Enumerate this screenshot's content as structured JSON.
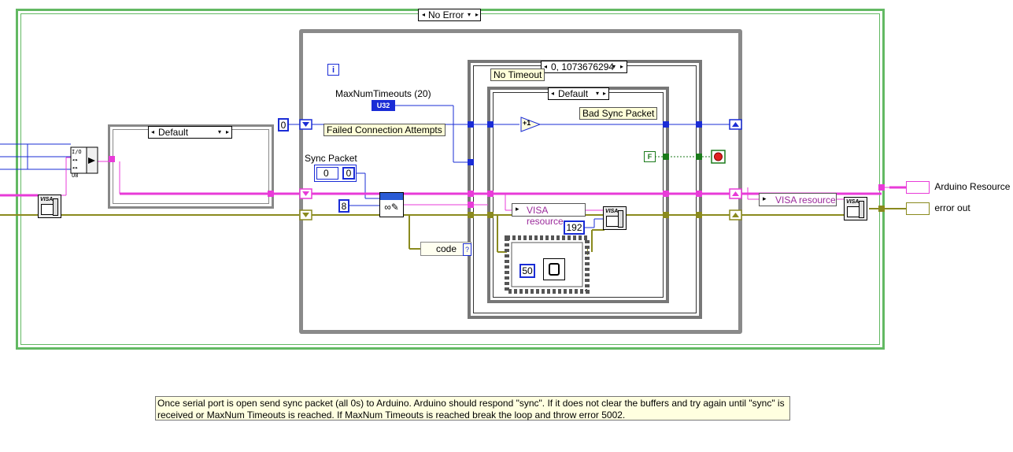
{
  "error_case": {
    "selector": "No Error"
  },
  "inner_case": {
    "selector": "Default"
  },
  "timeout_case": {
    "selector": "0, 1073676294",
    "label": "No Timeout"
  },
  "sync_case": {
    "selector": "Default",
    "label": "Bad Sync Packet"
  },
  "info_icon": "i",
  "max_num_timeouts": {
    "label": "MaxNumTimeouts (20)",
    "type_tag": "U32"
  },
  "shift_register_init": "0",
  "failed_attempts_label": "Failed Connection Attempts",
  "sync_packet": {
    "label": "Sync Packet",
    "index": "0",
    "value": "0"
  },
  "byte_count": "8",
  "read_count": "192",
  "wait_ms": "50",
  "code_label": "code",
  "increment": "+1",
  "false_const": "F",
  "visa_resource_inner": "VISA resource",
  "visa_resource_outer": "VISA resource",
  "visa_tag": "VISA",
  "outputs": {
    "resource": "Arduino Resource",
    "error": "error out"
  },
  "comment": "Once serial port is open send sync packet (all 0s) to Arduino.  Arduino should respond \"sync\".  If it does not clear the buffers and try again until \"sync\" is received or MaxNum Timeouts is reached.  If MaxNum Timeouts is reached break the loop and throw error 5002.",
  "colors": {
    "case_border": "#63b963",
    "visa_wire": "#e83bd8",
    "error_wire": "#8a8a1e",
    "numeric_wire": "#1a2cd6",
    "bool_wire": "#1a7a1a"
  }
}
